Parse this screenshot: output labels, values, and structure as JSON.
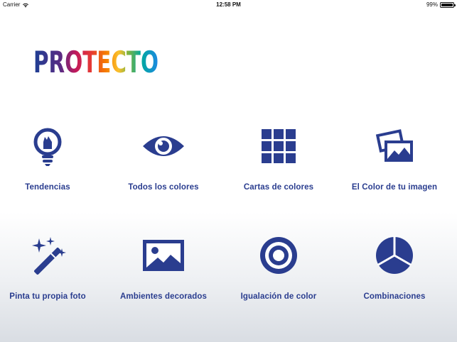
{
  "status": {
    "carrier": "Carrier",
    "time": "12:58 PM",
    "battery_text": "99%",
    "battery_level": 0.99
  },
  "brand": {
    "logo_text": "PROTECTO",
    "logo_colors": [
      "#1c3f94",
      "#5b2c83",
      "#c2185b",
      "#e53935",
      "#f57c00",
      "#fbc02d",
      "#7cb342",
      "#00a99d",
      "#1e88e5"
    ]
  },
  "accent_color": "#2a3d8f",
  "menu": [
    {
      "id": "tendencias",
      "label": "Tendencias",
      "icon": "lightbulb-icon"
    },
    {
      "id": "todos-colores",
      "label": "Todos los colores",
      "icon": "eye-icon"
    },
    {
      "id": "cartas-colores",
      "label": "Cartas de colores",
      "icon": "grid-icon"
    },
    {
      "id": "color-imagen",
      "label": "El Color de tu imagen",
      "icon": "photos-icon"
    },
    {
      "id": "pinta-foto",
      "label": "Pinta tu propia foto",
      "icon": "magic-wand-icon"
    },
    {
      "id": "ambientes",
      "label": "Ambientes decorados",
      "icon": "picture-icon"
    },
    {
      "id": "igualacion",
      "label": "Igualación de color",
      "icon": "target-icon"
    },
    {
      "id": "combinaciones",
      "label": "Combinaciones",
      "icon": "color-wheel-icon"
    }
  ]
}
